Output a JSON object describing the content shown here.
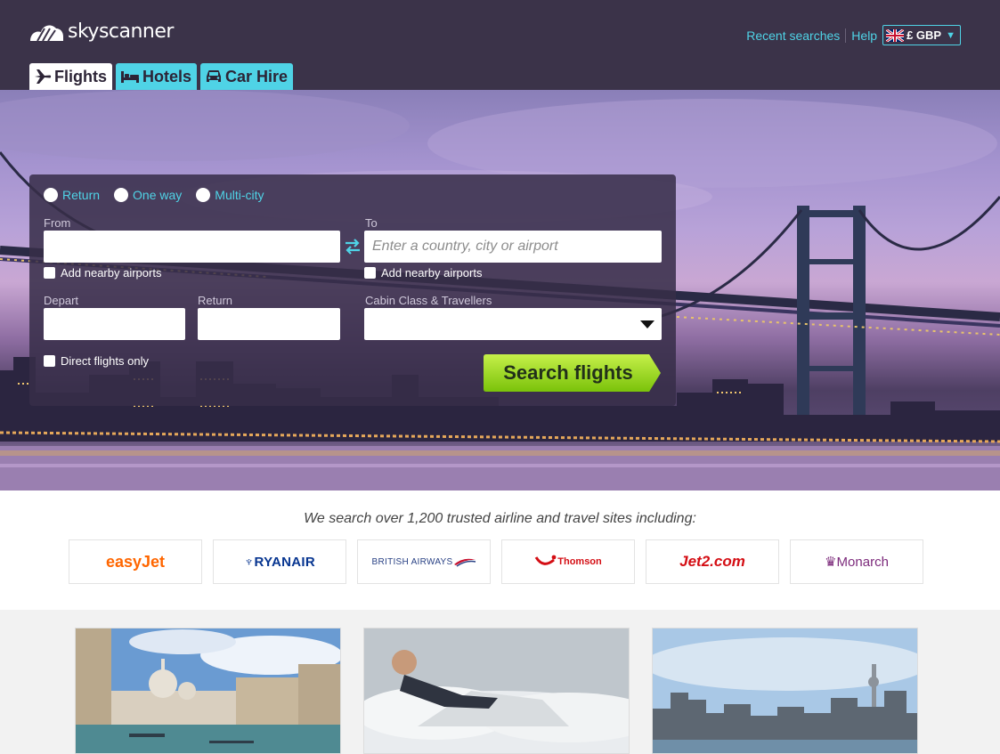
{
  "brand": {
    "name": "skyscanner"
  },
  "topnav": {
    "recent_searches": "Recent searches",
    "help": "Help",
    "currency": "£ GBP"
  },
  "tabs": [
    {
      "label": "Flights",
      "icon": "plane-icon",
      "active": true
    },
    {
      "label": "Hotels",
      "icon": "bed-icon",
      "active": false
    },
    {
      "label": "Car Hire",
      "icon": "car-icon",
      "active": false
    }
  ],
  "search": {
    "trip_types": [
      "Return",
      "One way",
      "Multi-city"
    ],
    "from_label": "From",
    "to_label": "To",
    "from_value": "",
    "to_placeholder": "Enter a country, city or airport",
    "nearby_from": "Add nearby airports",
    "nearby_to": "Add nearby airports",
    "depart_label": "Depart",
    "return_label": "Return",
    "cabin_label": "Cabin Class & Travellers",
    "direct_only": "Direct flights only",
    "submit": "Search flights"
  },
  "partners": {
    "tagline": "We search over 1,200 trusted airline and travel sites including:",
    "logos": [
      "easyJet",
      "RYANAIR",
      "BRITISH AIRWAYS",
      "Thomson",
      "Jet2.com",
      "Monarch"
    ]
  },
  "colors": {
    "header_bg": "#3b3349",
    "accent": "#4fd3e6",
    "search_button": "#8ed40f"
  }
}
